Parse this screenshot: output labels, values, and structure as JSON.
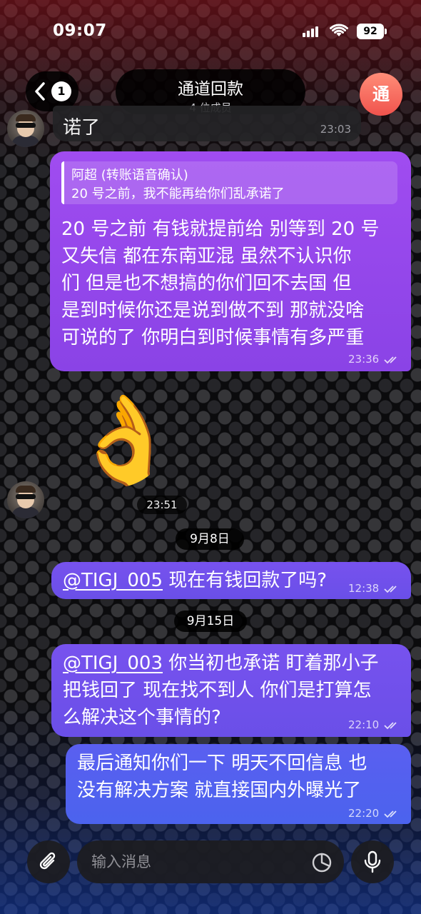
{
  "status_bar": {
    "time": "09:07",
    "battery": "92"
  },
  "header": {
    "back_badge_count": "1",
    "title": "通道回款",
    "subtitle": "4 位成员",
    "group_avatar_letter": "通"
  },
  "messages": {
    "incoming_partial": {
      "text": "诺了",
      "time": "23:03"
    },
    "reply_message": {
      "reply_author": "阿超 (转账语音确认)",
      "reply_text": "20 号之前，我不能再给你们乱承诺了",
      "lines": [
        "20 号之前  有钱就提前给  别等到 20 号",
        "又失信  都在东南亚混  虽然不认识你",
        "们  但是也不想搞的你们回不去国  但",
        "是到时候你还是说到做不到   那就没啥",
        "可说的了   你明白到时候事情有多严重"
      ],
      "time": "23:36"
    },
    "sticker": {
      "emoji": "👌",
      "time": "23:51"
    },
    "date_1": "9月8日",
    "message_2": {
      "mention": "@TIGJ_005",
      "text": " 现在有钱回款了吗?",
      "time": "12:38"
    },
    "date_2": "9月15日",
    "message_3": {
      "mention": "@TIGJ_003",
      "line1_rest": " 你当初也承诺 盯着那小子",
      "line2": "把钱回了  现在找不到人 你们是打算怎",
      "line3": "么解决这个事情的?",
      "time": "22:10"
    },
    "message_4": {
      "line1": "最后通知你们一下  明天不回信息  也",
      "line2": "没有解决方案  就直接国内外曝光了",
      "time": "22:20"
    }
  },
  "input": {
    "placeholder": "输入消息"
  },
  "icons": {
    "back": "chevron-left-icon",
    "attach": "paperclip-icon",
    "sticker": "sticker-icon",
    "mic": "microphone-icon",
    "read": "double-check-icon"
  }
}
